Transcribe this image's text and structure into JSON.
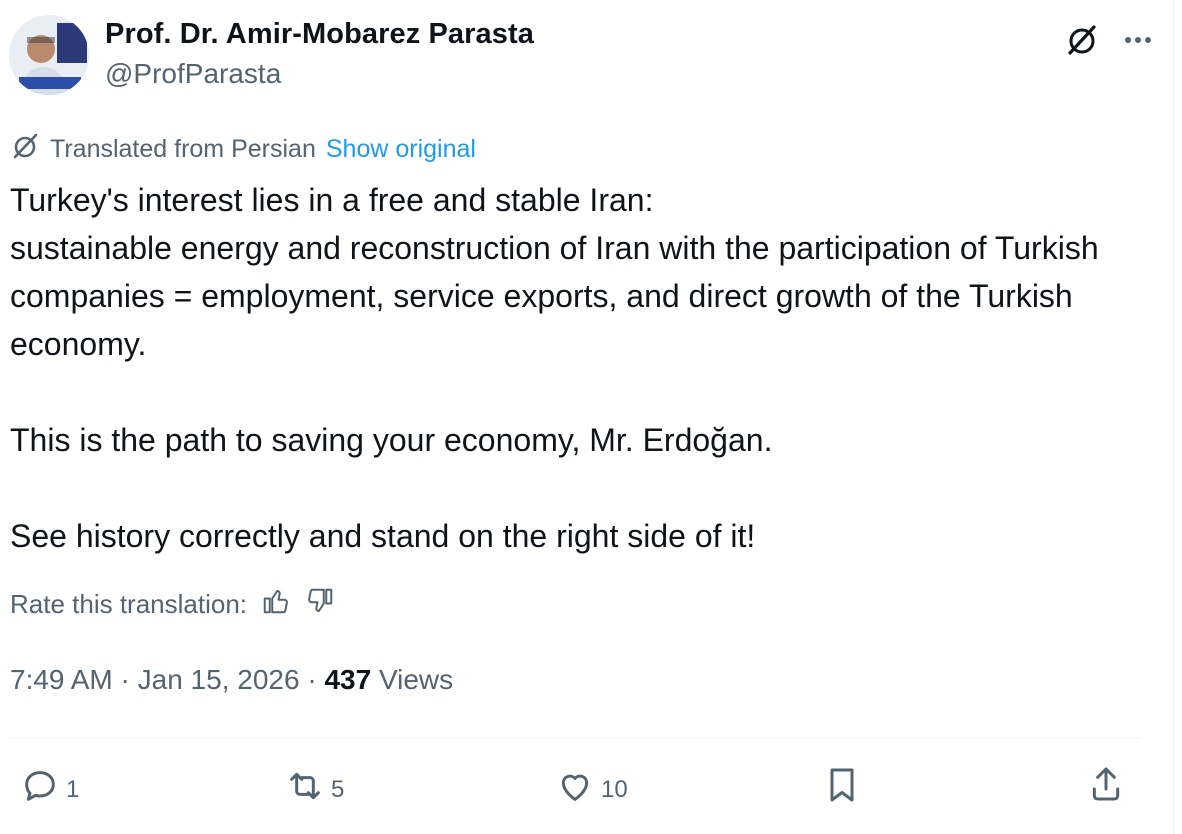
{
  "author": {
    "display_name": "Prof. Dr. Amir-Mobarez Parasta",
    "handle": "@ProfParasta"
  },
  "translation": {
    "label": "Translated from Persian",
    "show_original": "Show original"
  },
  "tweet": {
    "text": "Turkey's interest lies in a free and stable Iran:\nsustainable energy and reconstruction of Iran with the participation of Turkish companies = employment, service exports, and direct growth of the Turkish economy.\n\nThis is the path to saving your economy, Mr. Erdoğan.\n\nSee history correctly and stand on the right side of it!"
  },
  "rating": {
    "label": "Rate this translation:"
  },
  "meta": {
    "time": "7:49 AM",
    "date": "Jan 15, 2026",
    "views_count": "437",
    "views_label": "Views"
  },
  "actions": {
    "replies": "1",
    "reposts": "5",
    "likes": "10"
  },
  "icons": {
    "grok": "grok-slash-icon",
    "more": "more-icon",
    "translate": "grok-slash-icon",
    "thumbs_up": "thumbs-up-icon",
    "thumbs_down": "thumbs-down-icon",
    "reply": "reply-icon",
    "repost": "repost-icon",
    "like": "like-icon",
    "bookmark": "bookmark-icon",
    "share": "share-icon"
  },
  "colors": {
    "link": "#1d9bf0",
    "secondary": "#536471",
    "primary": "#0f1419"
  }
}
